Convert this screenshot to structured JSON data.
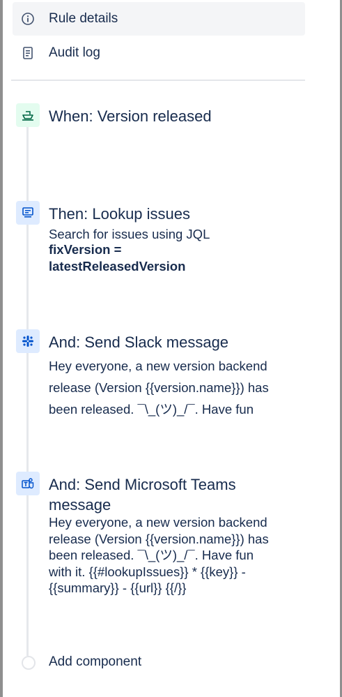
{
  "nav": {
    "rule_details": "Rule details",
    "audit_log": "Audit log"
  },
  "steps": {
    "trigger": {
      "title": "When: Version released",
      "icon": "ship-icon"
    },
    "lookup": {
      "title": "Then: Lookup issues",
      "desc": "Search for issues using JQL",
      "jql_line1": "fixVersion =",
      "jql_line2": "latestReleasedVersion",
      "icon": "monitor-icon"
    },
    "slack": {
      "title": "And: Send Slack message",
      "lines": [
        "Hey everyone, a new version backend",
        "release (Version {{version.name}}) has",
        "been released. ¯\\_(ツ)_/¯. Have fun"
      ],
      "icon": "slack-icon"
    },
    "teams": {
      "title_line1": "And: Send Microsoft Teams",
      "title_line2": "message",
      "lines": [
        "Hey everyone, a new version backend",
        "release (Version {{version.name}}) has",
        "been released. ¯\\_(ツ)_/¯. Have fun",
        "with it. {{#lookupIssues}} * {{key}} -",
        "{{summary}} - {{url}} {{/}}"
      ],
      "icon": "teams-icon"
    }
  },
  "add_component": "Add component",
  "colors": {
    "text": "#172b4d",
    "trigger_bg": "#e3fcef",
    "trigger_fg": "#006644",
    "action_bg": "#deebff",
    "action_fg": "#0052cc",
    "nav_active_bg": "#f4f5f7"
  }
}
